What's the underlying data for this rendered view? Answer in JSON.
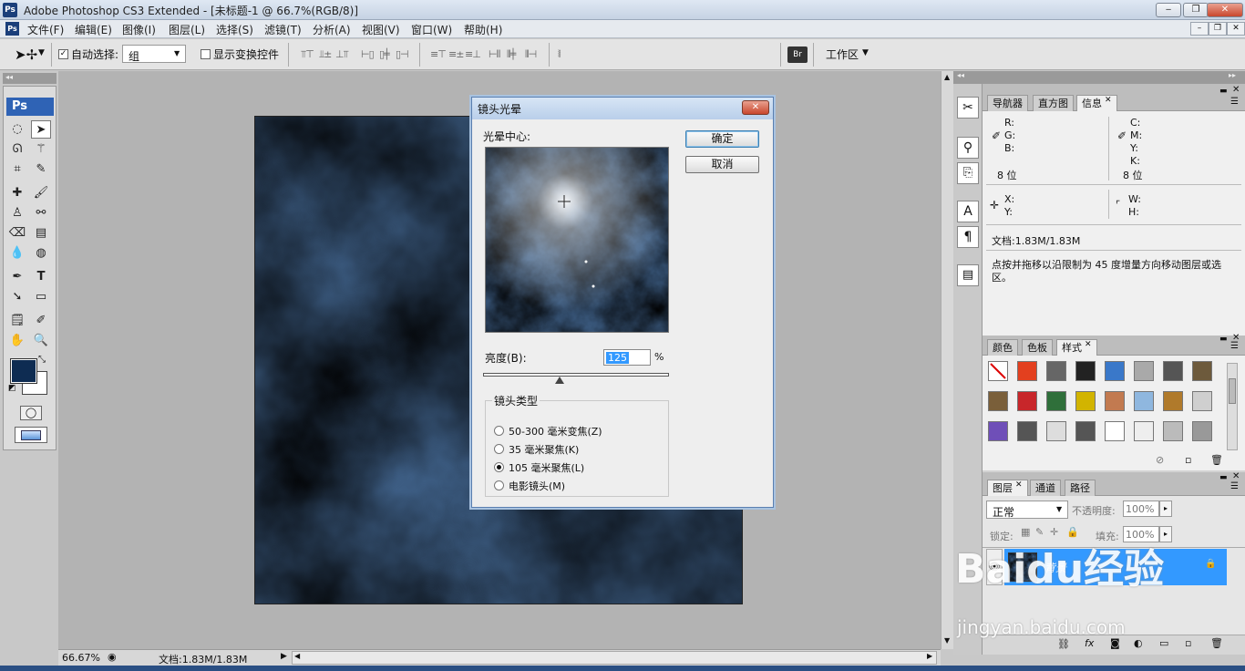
{
  "app": {
    "title": "Adobe Photoshop CS3 Extended - [未标题-1 @ 66.7%(RGB/8)]",
    "logo": "Ps"
  },
  "menu": [
    "文件(F)",
    "编辑(E)",
    "图像(I)",
    "图层(L)",
    "选择(S)",
    "滤镜(T)",
    "分析(A)",
    "视图(V)",
    "窗口(W)",
    "帮助(H)"
  ],
  "options": {
    "auto_select_label": "自动选择:",
    "auto_select_value": "组",
    "show_transform_label": "显示变换控件",
    "workspace_label": "工作区"
  },
  "dialog": {
    "title": "镜头光晕",
    "flare_center_label": "光晕中心:",
    "ok": "确定",
    "cancel": "取消",
    "brightness_label": "亮度(B):",
    "brightness_value": "125",
    "brightness_unit": "%",
    "brightness_fraction": 0.41,
    "lens_group_label": "镜头类型",
    "lens_options": [
      "50-300 毫米变焦(Z)",
      "35 毫米聚焦(K)",
      "105 毫米聚焦(L)",
      "电影镜头(M)"
    ],
    "lens_selected_index": 2
  },
  "info_panel": {
    "tabs": [
      "导航器",
      "直方图",
      "信息"
    ],
    "rgb": [
      "R:",
      "G:",
      "B:"
    ],
    "cmyk": [
      "C:",
      "M:",
      "Y:",
      "K:"
    ],
    "bits_left": "8 位",
    "bits_right": "8 位",
    "xy": [
      "X:",
      "Y:"
    ],
    "wh": [
      "W:",
      "H:"
    ],
    "doc": "文档:1.83M/1.83M",
    "hint": "点按并拖移以沿限制为 45 度增量方向移动图层或选区。"
  },
  "styles_panel": {
    "tabs": [
      "颜色",
      "色板",
      "样式"
    ]
  },
  "layers_panel": {
    "tabs": [
      "图层",
      "通道",
      "路径"
    ],
    "blend_mode": "正常",
    "opacity_label": "不透明度:",
    "opacity_value": "100%",
    "lock_label": "锁定:",
    "fill_label": "填充:",
    "fill_value": "100%",
    "layer_name": "背景"
  },
  "status": {
    "zoom": "66.67%",
    "doc": "文档:1.83M/1.83M"
  },
  "watermark": {
    "brand": "Baidu经验",
    "url": "jingyan.baidu.com"
  },
  "colors": {
    "accent": "#3399ff",
    "fg_color": "#0e2c52",
    "dialog_border": "#5a7fb0"
  }
}
